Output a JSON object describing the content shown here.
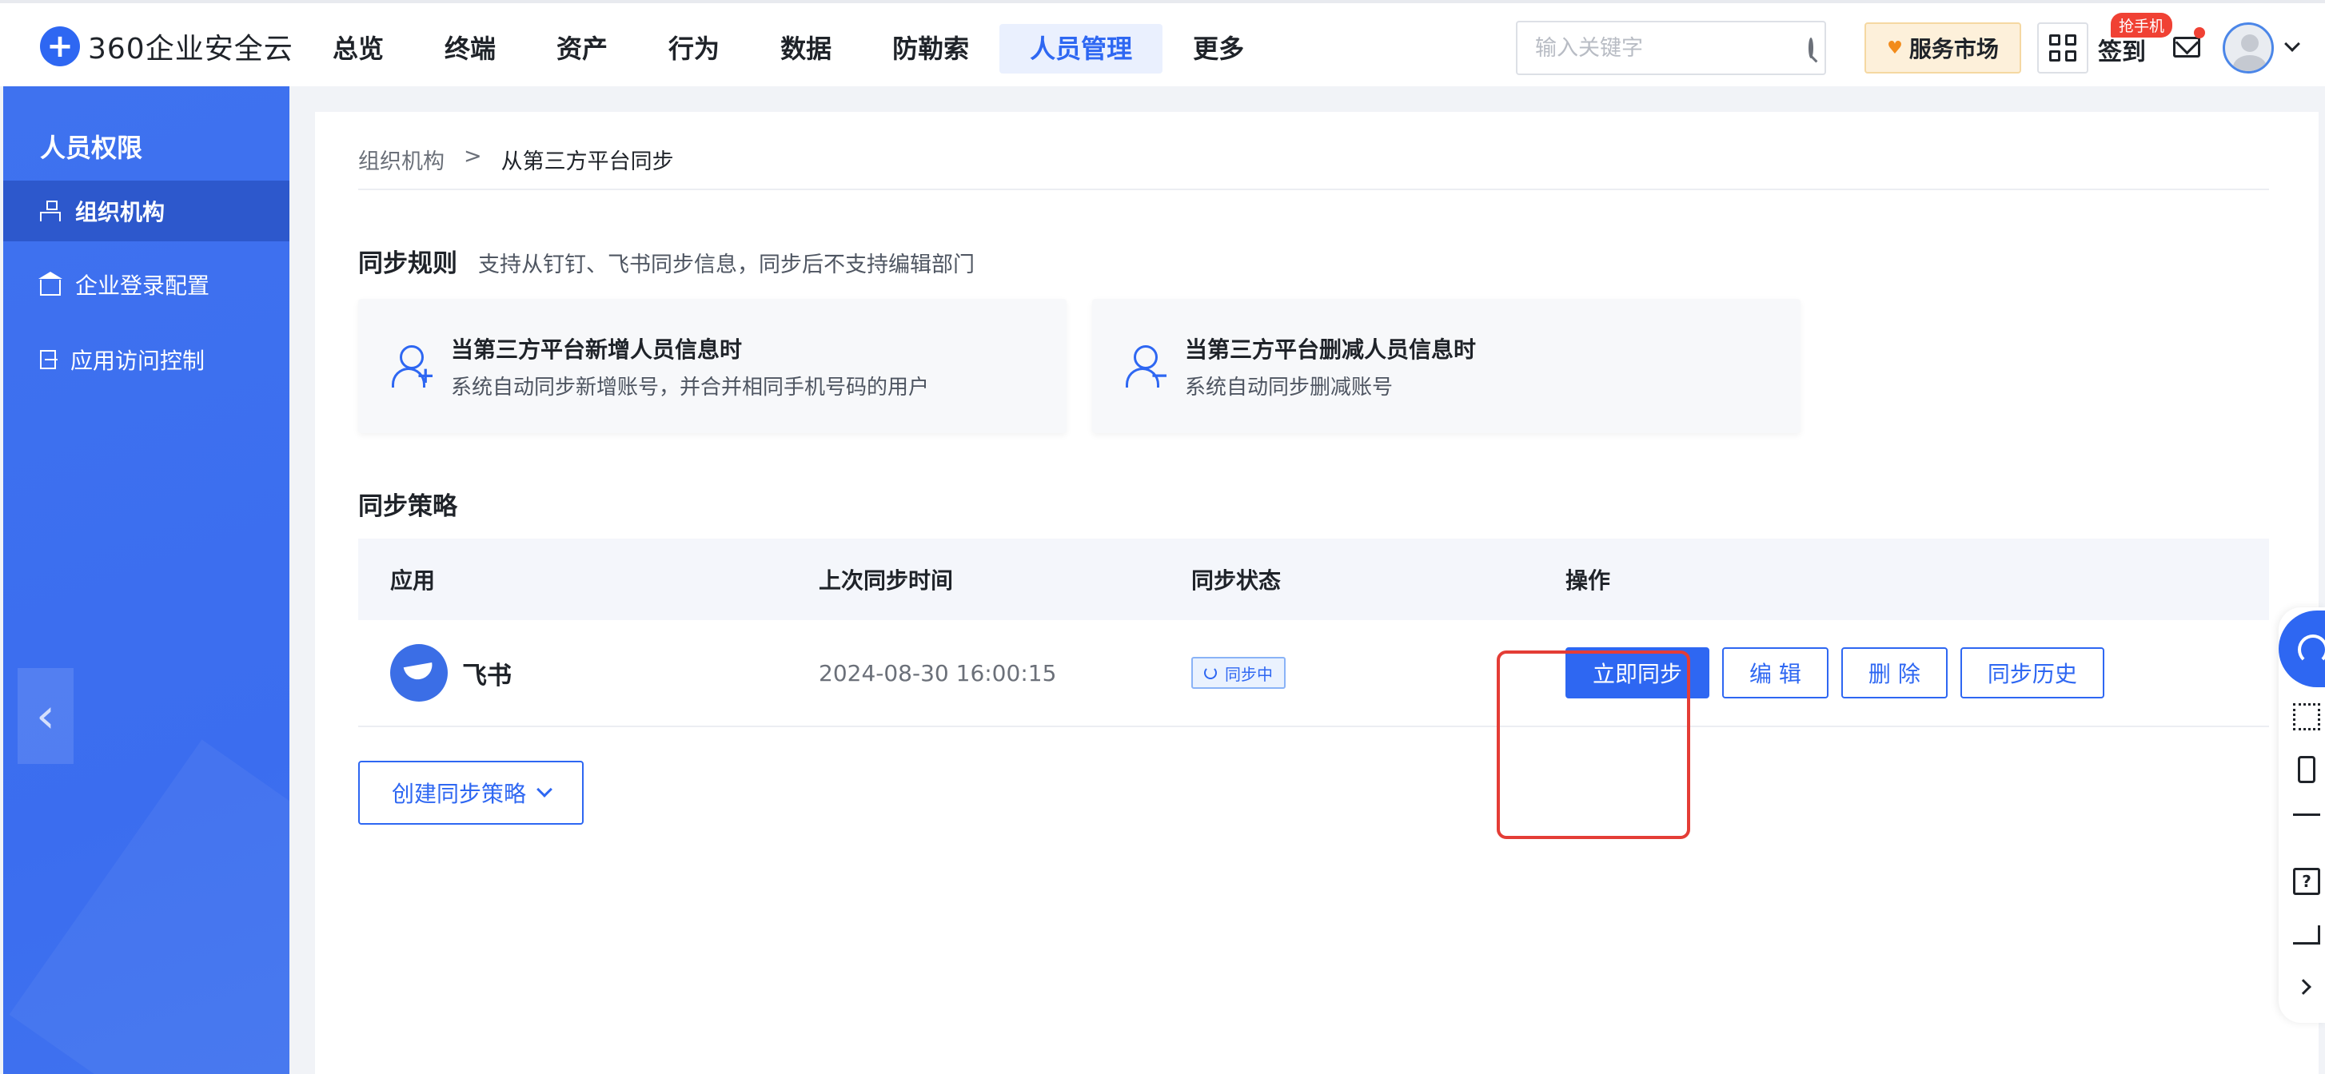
{
  "header": {
    "logo_text": "360企业安全云",
    "nav": [
      "总览",
      "终端",
      "资产",
      "行为",
      "数据",
      "防勒索",
      "人员管理",
      "更多"
    ],
    "active_nav": "人员管理",
    "search_placeholder": "输入关键字",
    "market_label": "服务市场",
    "signin_label": "签到",
    "phone_badge": "抢手机"
  },
  "sidebar": {
    "title": "人员权限",
    "items": [
      {
        "label": "组织机构",
        "active": true
      },
      {
        "label": "企业登录配置",
        "active": false
      },
      {
        "label": "应用访问控制",
        "active": false
      }
    ]
  },
  "breadcrumb": {
    "parent": "组织机构",
    "separator": ">",
    "current": "从第三方平台同步"
  },
  "sync_rules": {
    "title": "同步规则",
    "desc": "支持从钉钉、飞书同步信息，同步后不支持编辑部门",
    "cards": [
      {
        "title": "当第三方平台新增人员信息时",
        "desc": "系统自动同步新增账号，并合并相同手机号码的用户",
        "sign": "+"
      },
      {
        "title": "当第三方平台删减人员信息时",
        "desc": "系统自动同步删减账号",
        "sign": "−"
      }
    ]
  },
  "strategy": {
    "title": "同步策略",
    "columns": [
      "应用",
      "上次同步时间",
      "同步状态",
      "操作"
    ],
    "rows": [
      {
        "app": "飞书",
        "last_sync": "2024-08-30 16:00:15",
        "status": "同步中",
        "actions": [
          "立即同步",
          "编 辑",
          "删 除",
          "同步历史"
        ]
      }
    ],
    "create_label": "创建同步策略"
  },
  "colors": {
    "brand": "#2e67f2",
    "sidebar": "#3b6def",
    "highlight": "#e43d36"
  }
}
